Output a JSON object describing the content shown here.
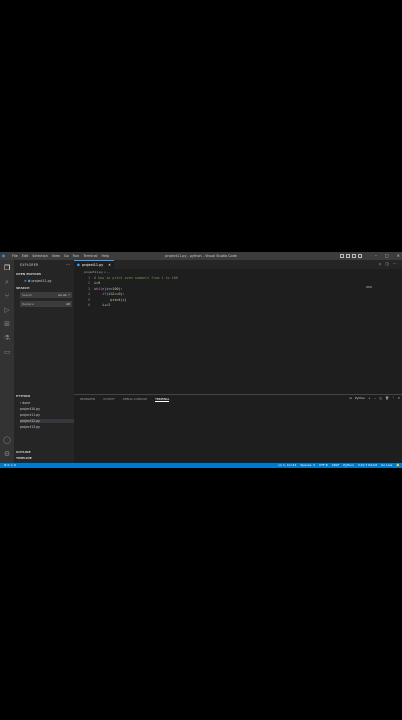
{
  "window": {
    "title": "project11.py - python - Visual Studio Code",
    "menu": [
      "File",
      "Edit",
      "Selection",
      "View",
      "Go",
      "Run",
      "Terminal",
      "Help"
    ]
  },
  "sidebar": {
    "title": "EXPLORER",
    "open_editors_label": "OPEN EDITORS",
    "open_file": "project11.py",
    "search_label": "SEARCH",
    "search_placeholder": "Search",
    "search_opts": "Aa ab .*",
    "replace_placeholder": "Replace",
    "replace_opts": "AB",
    "python_label": "PYTHON",
    "python_folder": "done",
    "files": [
      "project10.py",
      "project11.py",
      "project12.py",
      "project13.py"
    ],
    "active_file": "project12.py",
    "outline_label": "OUTLINE",
    "timeline_label": "TIMELINE"
  },
  "editor": {
    "tab_label": "project11.py",
    "breadcrumb": "project11.py > ...",
    "lines": [
      {
        "n": "1",
        "parts": [
          {
            "t": "# how to print even numbers from 1 to 100",
            "c": "cm"
          }
        ]
      },
      {
        "n": "2",
        "parts": [
          {
            "t": "i",
            "c": "var"
          },
          {
            "t": "=",
            "c": "op"
          },
          {
            "t": "0",
            "c": "num"
          }
        ]
      },
      {
        "n": "3",
        "parts": [
          {
            "t": "while",
            "c": "kw"
          },
          {
            "t": "(",
            "c": "op"
          },
          {
            "t": "i",
            "c": "var"
          },
          {
            "t": "<=",
            "c": "op"
          },
          {
            "t": "100",
            "c": "num"
          },
          {
            "t": "):",
            "c": "op"
          }
        ]
      },
      {
        "n": "4",
        "parts": [
          {
            "t": "    ",
            "c": "op"
          },
          {
            "t": "if",
            "c": "kw"
          },
          {
            "t": "(",
            "c": "op"
          },
          {
            "t": "i",
            "c": "var"
          },
          {
            "t": "%",
            "c": "op"
          },
          {
            "t": "2",
            "c": "num"
          },
          {
            "t": "==",
            "c": "op"
          },
          {
            "t": "0",
            "c": "num"
          },
          {
            "t": "):",
            "c": "op"
          }
        ]
      },
      {
        "n": "5",
        "parts": [
          {
            "t": "        ",
            "c": "op"
          },
          {
            "t": "print",
            "c": "fn"
          },
          {
            "t": "(",
            "c": "op"
          },
          {
            "t": "i",
            "c": "var"
          },
          {
            "t": ")",
            "c": "op"
          }
        ]
      },
      {
        "n": "6",
        "parts": [
          {
            "t": "    ",
            "c": "op"
          },
          {
            "t": "i",
            "c": "var"
          },
          {
            "t": "+=",
            "c": "op"
          },
          {
            "t": "2",
            "c": "num"
          }
        ]
      }
    ]
  },
  "panel": {
    "tabs": [
      "PROBLEMS",
      "OUTPUT",
      "DEBUG CONSOLE",
      "TERMINAL"
    ],
    "active_tab": "TERMINAL",
    "terminal_label": "Python"
  },
  "statusbar": {
    "left": "⊗ 0 ⚠ 0",
    "items": [
      "Ln 1, Col 41",
      "Spaces: 4",
      "UTF-8",
      "CRLF",
      "Python",
      "3.10.7 64-bit",
      "Go Live"
    ]
  },
  "colors": {
    "statusbar": "#007acc",
    "titlebar": "#3c3c3c",
    "sidebar": "#252526",
    "editor": "#1e1e1e"
  }
}
